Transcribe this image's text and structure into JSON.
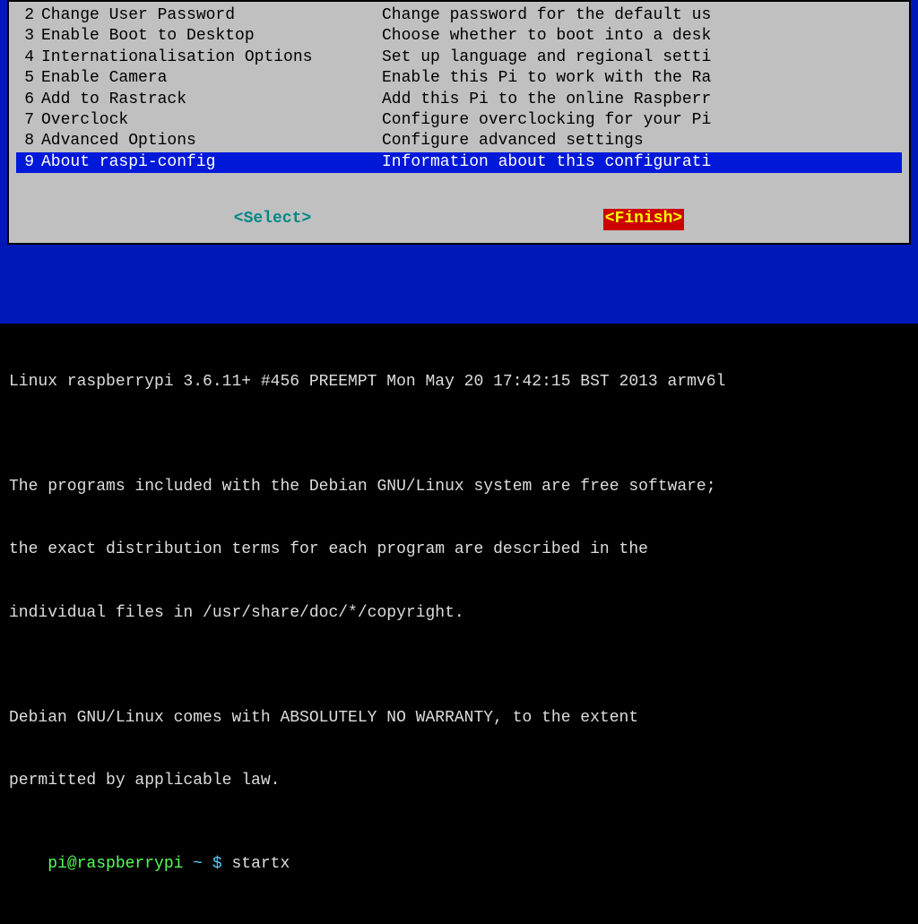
{
  "menu": [
    {
      "num": "2",
      "label": "Change User Password",
      "desc": "Change password for the default us"
    },
    {
      "num": "3",
      "label": "Enable Boot to Desktop",
      "desc": "Choose whether to boot into a desk"
    },
    {
      "num": "4",
      "label": "Internationalisation Options",
      "desc": "Set up language and regional setti"
    },
    {
      "num": "5",
      "label": "Enable Camera",
      "desc": "Enable this Pi to work with the Ra"
    },
    {
      "num": "6",
      "label": "Add to Rastrack",
      "desc": "Add this Pi to the online Raspberr"
    },
    {
      "num": "7",
      "label": "Overclock",
      "desc": "Configure overclocking for your Pi"
    },
    {
      "num": "8",
      "label": "Advanced Options",
      "desc": "Configure advanced settings"
    },
    {
      "num": "9",
      "label": "About raspi-config",
      "desc": "Information about this configurati",
      "selected": true
    }
  ],
  "buttons": {
    "select": "<Select>",
    "finish": "<Finish>"
  },
  "terminal": {
    "line1": "Linux raspberrypi 3.6.11+ #456 PREEMPT Mon May 20 17:42:15 BST 2013 armv6l",
    "line2": "",
    "line3": "The programs included with the Debian GNU/Linux system are free software;",
    "line4": "the exact distribution terms for each program are described in the",
    "line5": "individual files in /usr/share/doc/*/copyright.",
    "line6": "",
    "line7": "Debian GNU/Linux comes with ABSOLUTELY NO WARRANTY, to the extent",
    "line8": "permitted by applicable law.",
    "prompt_user": "pi@raspberrypi",
    "prompt_sep": " ~ $ ",
    "prompt_cmd": "startx"
  }
}
